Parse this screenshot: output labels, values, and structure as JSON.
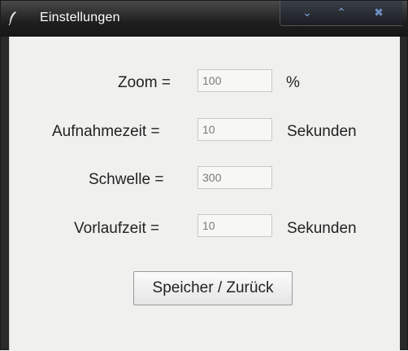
{
  "window": {
    "title": "Einstellungen"
  },
  "form": {
    "zoom": {
      "label": "Zoom =",
      "value": "100",
      "unit": "%"
    },
    "aufnahmezeit": {
      "label": "Aufnahmezeit =",
      "value": "10",
      "unit": "Sekunden"
    },
    "schwelle": {
      "label": "Schwelle =",
      "value": "300"
    },
    "vorlaufzeit": {
      "label": "Vorlaufzeit =",
      "value": "10",
      "unit": "Sekunden"
    }
  },
  "button": {
    "label": "Speicher / Zurück"
  },
  "icons": {
    "app": "feather-icon",
    "minimize": "minimize-icon",
    "maximize": "maximize-icon",
    "close": "close-icon"
  }
}
